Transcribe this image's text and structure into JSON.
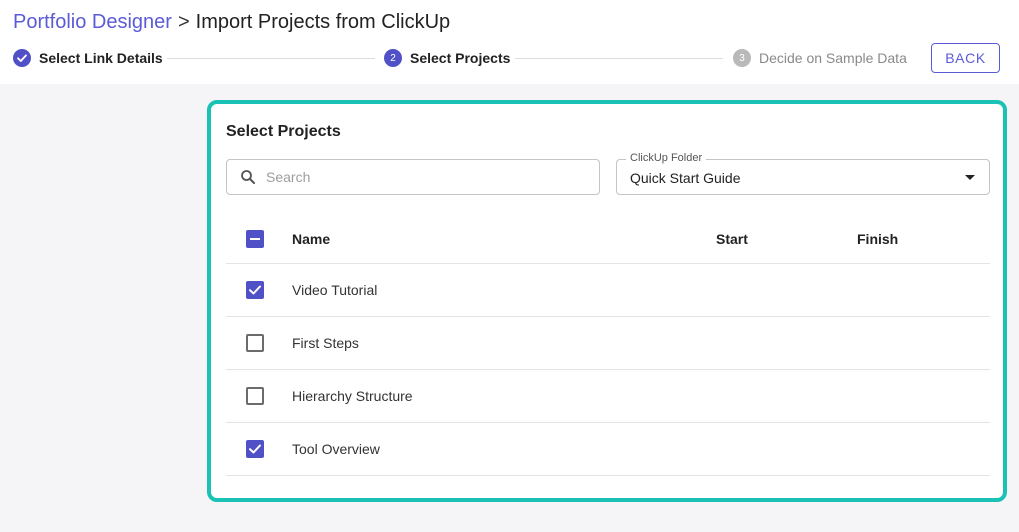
{
  "breadcrumb": {
    "parent": "Portfolio Designer",
    "separator": ">",
    "current": "Import Projects from ClickUp"
  },
  "stepper": {
    "steps": [
      {
        "label": "Select Link Details",
        "number": "1",
        "state": "done"
      },
      {
        "label": "Select Projects",
        "number": "2",
        "state": "active"
      },
      {
        "label": "Decide on Sample Data",
        "number": "3",
        "state": "pending"
      }
    ]
  },
  "toolbar": {
    "back_label": "BACK"
  },
  "panel": {
    "title": "Select Projects",
    "search": {
      "placeholder": "Search",
      "value": ""
    },
    "folder_select": {
      "label": "ClickUp Folder",
      "value": "Quick Start Guide"
    }
  },
  "table": {
    "columns": {
      "name": "Name",
      "start": "Start",
      "finish": "Finish"
    },
    "select_all_state": "indeterminate",
    "rows": [
      {
        "name": "Video Tutorial",
        "checked": true
      },
      {
        "name": "First Steps",
        "checked": false
      },
      {
        "name": "Hierarchy Structure",
        "checked": false
      },
      {
        "name": "Tool Overview",
        "checked": true
      }
    ]
  },
  "colors": {
    "accent": "#5151c7",
    "link": "#5b5bd6",
    "panel_border": "#19c2b4",
    "pending": "#b9b9b9"
  },
  "icons": {
    "search": "search-icon",
    "check": "check-icon",
    "caret": "caret-down-icon"
  }
}
